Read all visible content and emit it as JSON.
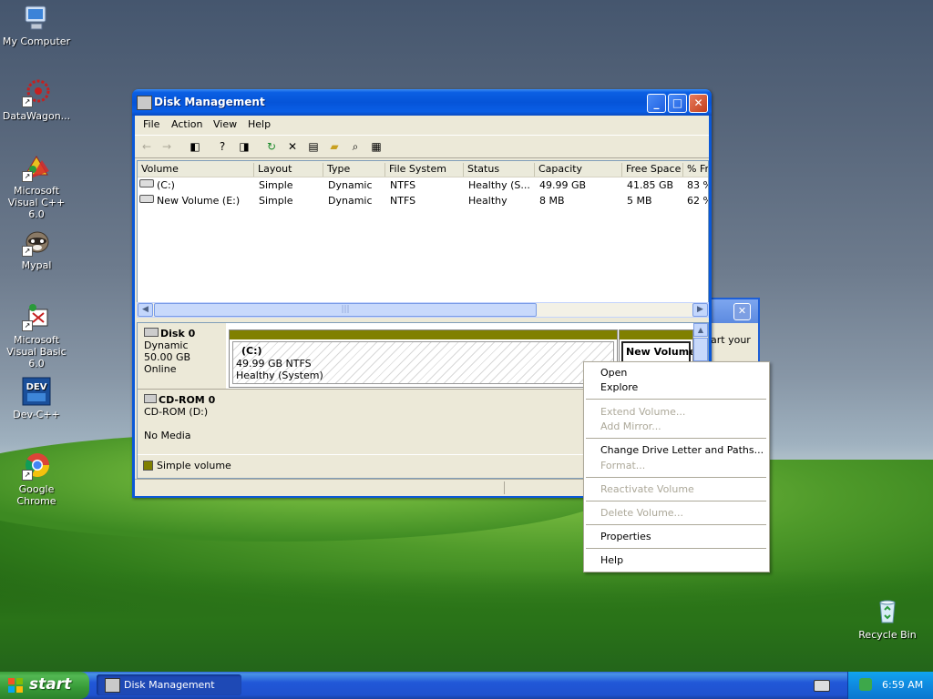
{
  "desktop": {
    "icons": [
      {
        "label": "My Computer",
        "icon": "my-computer-icon"
      },
      {
        "label": "DataWagon...",
        "icon": "datawagon-icon"
      },
      {
        "label": "Microsoft Visual C++ 6.0",
        "icon": "visual-cpp-icon"
      },
      {
        "label": "Mypal",
        "icon": "mypal-icon"
      },
      {
        "label": "Microsoft Visual Basic 6.0",
        "icon": "visual-basic-icon"
      },
      {
        "label": "Dev-C++",
        "icon": "dev-cpp-icon"
      },
      {
        "label": "Google Chrome",
        "icon": "chrome-icon"
      },
      {
        "label": "Recycle Bin",
        "icon": "recycle-bin-icon"
      }
    ],
    "behind_window_text": "art your"
  },
  "window": {
    "title": "Disk Management",
    "menu": [
      "File",
      "Action",
      "View",
      "Help"
    ],
    "volume_list": {
      "columns": [
        "Volume",
        "Layout",
        "Type",
        "File System",
        "Status",
        "Capacity",
        "Free Space",
        "% Fr"
      ],
      "rows": [
        [
          "(C:)",
          "Simple",
          "Dynamic",
          "NTFS",
          "Healthy (S...",
          "49.99 GB",
          "41.85 GB",
          "83 %"
        ],
        [
          "New Volume (E:)",
          "Simple",
          "Dynamic",
          "NTFS",
          "Healthy",
          "8 MB",
          "5 MB",
          "62 %"
        ]
      ]
    },
    "disks": [
      {
        "name": "Disk 0",
        "line1": "Dynamic",
        "line2": "50.00 GB",
        "line3": "Online"
      },
      {
        "name": "CD-ROM 0",
        "line1": "CD-ROM (D:)",
        "line2": "",
        "line3": "No Media"
      }
    ],
    "partitions": {
      "c": {
        "name": "(C:)",
        "size": "49.99 GB NTFS",
        "status": "Healthy (System)"
      },
      "e": {
        "name": "New Volume"
      }
    },
    "legend": "Simple volume",
    "colors": {
      "simple_volume": "#808000"
    }
  },
  "context_menu": {
    "items": [
      {
        "label": "Open",
        "enabled": true
      },
      {
        "label": "Explore",
        "enabled": true
      },
      {
        "label": "Extend Volume...",
        "enabled": false
      },
      {
        "label": "Add Mirror...",
        "enabled": false
      },
      {
        "label": "Change Drive Letter and Paths...",
        "enabled": true
      },
      {
        "label": "Format...",
        "enabled": false
      },
      {
        "label": "Reactivate Volume",
        "enabled": false
      },
      {
        "label": "Delete Volume...",
        "enabled": false
      },
      {
        "label": "Properties",
        "enabled": true
      },
      {
        "label": "Help",
        "enabled": true
      }
    ]
  },
  "taskbar": {
    "start_label": "start",
    "task_button": "Disk Management",
    "clock": "6:59 AM"
  }
}
